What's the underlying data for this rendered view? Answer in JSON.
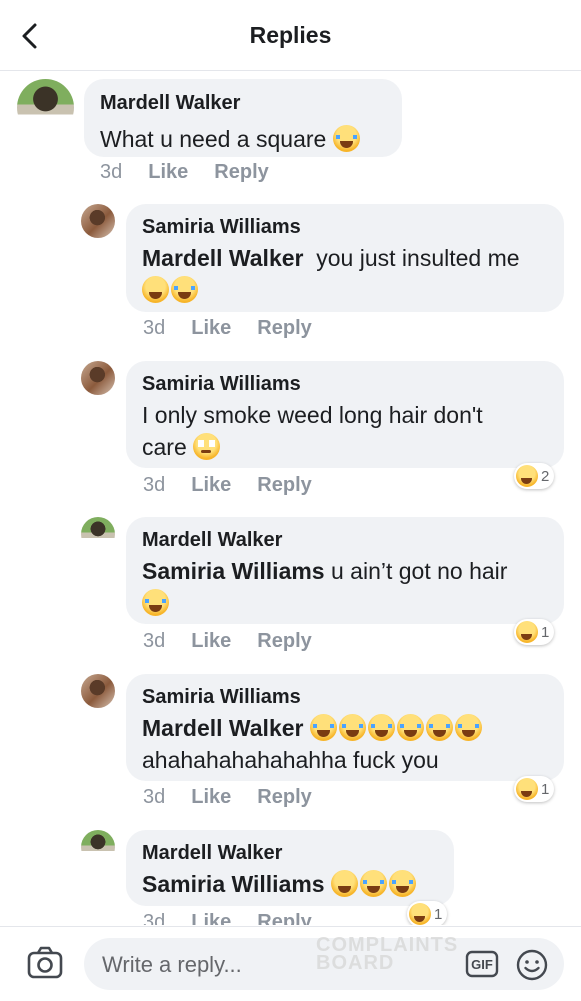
{
  "header": {
    "title": "Replies",
    "back_icon": "back-arrow-icon"
  },
  "comments": [
    {
      "author": "Mardell Walker",
      "mention": "",
      "text": "What u need a square",
      "emojis": [
        "cry"
      ],
      "time": "3d",
      "like": "Like",
      "reply": "Reply",
      "reactions": ""
    },
    {
      "author": "Samiria Williams",
      "mention": "Mardell Walker",
      "text": "you just insulted me",
      "emojis": [
        "laugh",
        "cry"
      ],
      "time": "3d",
      "like": "Like",
      "reply": "Reply",
      "reactions": ""
    },
    {
      "author": "Samiria Williams",
      "mention": "",
      "text": "I only smoke weed long hair don't",
      "text2": "care",
      "emojis": [
        "roll"
      ],
      "time": "3d",
      "like": "Like",
      "reply": "Reply",
      "reactions": "2"
    },
    {
      "author": "Mardell Walker",
      "mention": "Samiria Williams",
      "text": "u ain’t got no hair",
      "emojis": [
        "cry"
      ],
      "time": "3d",
      "like": "Like",
      "reply": "Reply",
      "reactions": "1"
    },
    {
      "author": "Samiria Williams",
      "mention": "Mardell Walker",
      "text": "ahahahahahahahha fuck you",
      "emojis": [
        "cry",
        "cry",
        "cry",
        "cry",
        "cry",
        "cry"
      ],
      "time": "3d",
      "like": "Like",
      "reply": "Reply",
      "reactions": "1"
    },
    {
      "author": "Mardell Walker",
      "mention": "Samiria Williams",
      "text": "",
      "emojis": [
        "laugh",
        "cry",
        "cry"
      ],
      "time": "3d",
      "like": "Like",
      "reply": "Reply",
      "reactions": "1"
    }
  ],
  "composer": {
    "placeholder": "Write a reply...",
    "camera_icon": "camera-icon",
    "gif_label": "GIF",
    "emoji_icon": "smiley-icon"
  },
  "watermark": {
    "line1": "COMPLAINTS",
    "line2": "BOARD"
  }
}
